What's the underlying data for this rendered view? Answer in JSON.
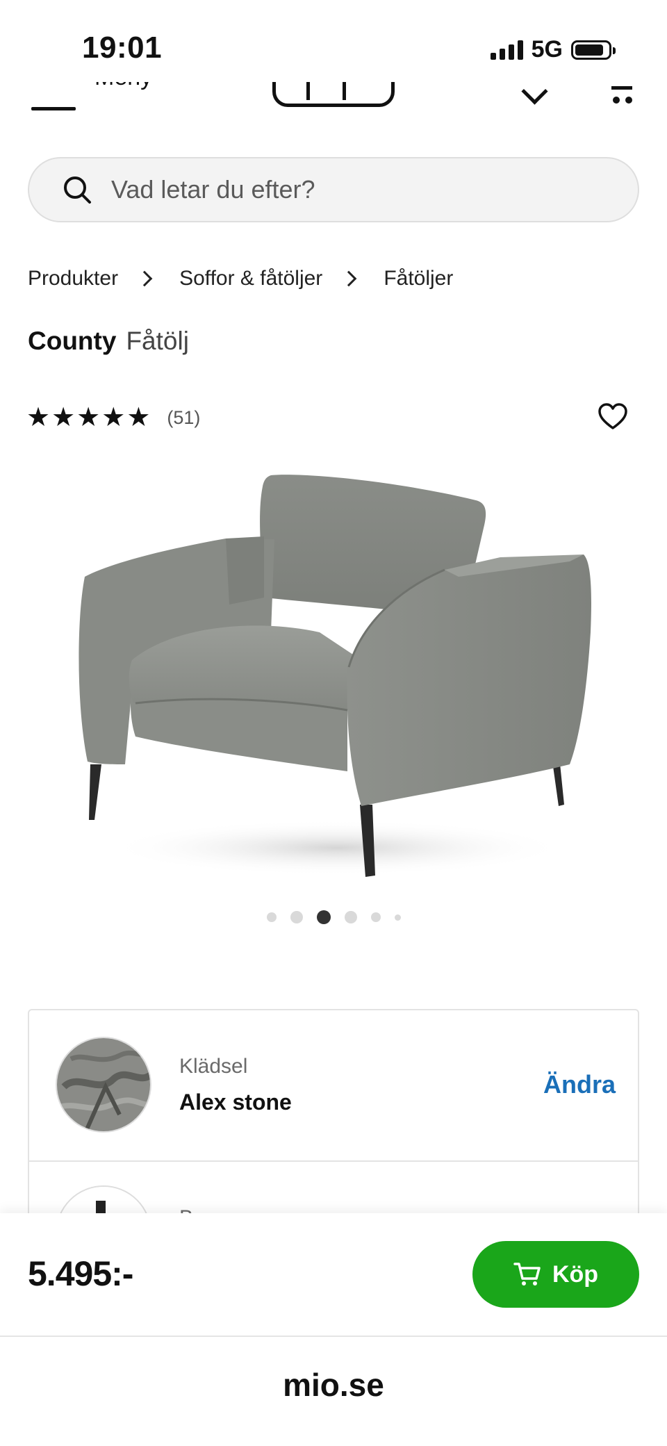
{
  "status_bar": {
    "time": "19:01",
    "network": "5G"
  },
  "nav": {
    "menu_label": "Meny"
  },
  "search": {
    "placeholder": "Vad letar du efter?"
  },
  "breadcrumb": [
    "Produkter",
    "Soffor & fåtöljer",
    "Fåtöljer"
  ],
  "product": {
    "brand": "County",
    "type": "Fåtölj",
    "rating": 5,
    "rating_max": 5,
    "review_count": "(51)",
    "colors": {
      "fabric": "#8e918c"
    }
  },
  "carousel": {
    "count": 6,
    "active_index": 2
  },
  "options": [
    {
      "label": "Klädsel",
      "value": "Alex stone",
      "action": "Ändra"
    },
    {
      "label": "B"
    }
  ],
  "purchase": {
    "price": "5.495:-",
    "buy_label": "Köp"
  },
  "browser": {
    "url": "mio.se"
  },
  "colors": {
    "buy_button": "#1aa61a",
    "link": "#1a6fb8"
  }
}
